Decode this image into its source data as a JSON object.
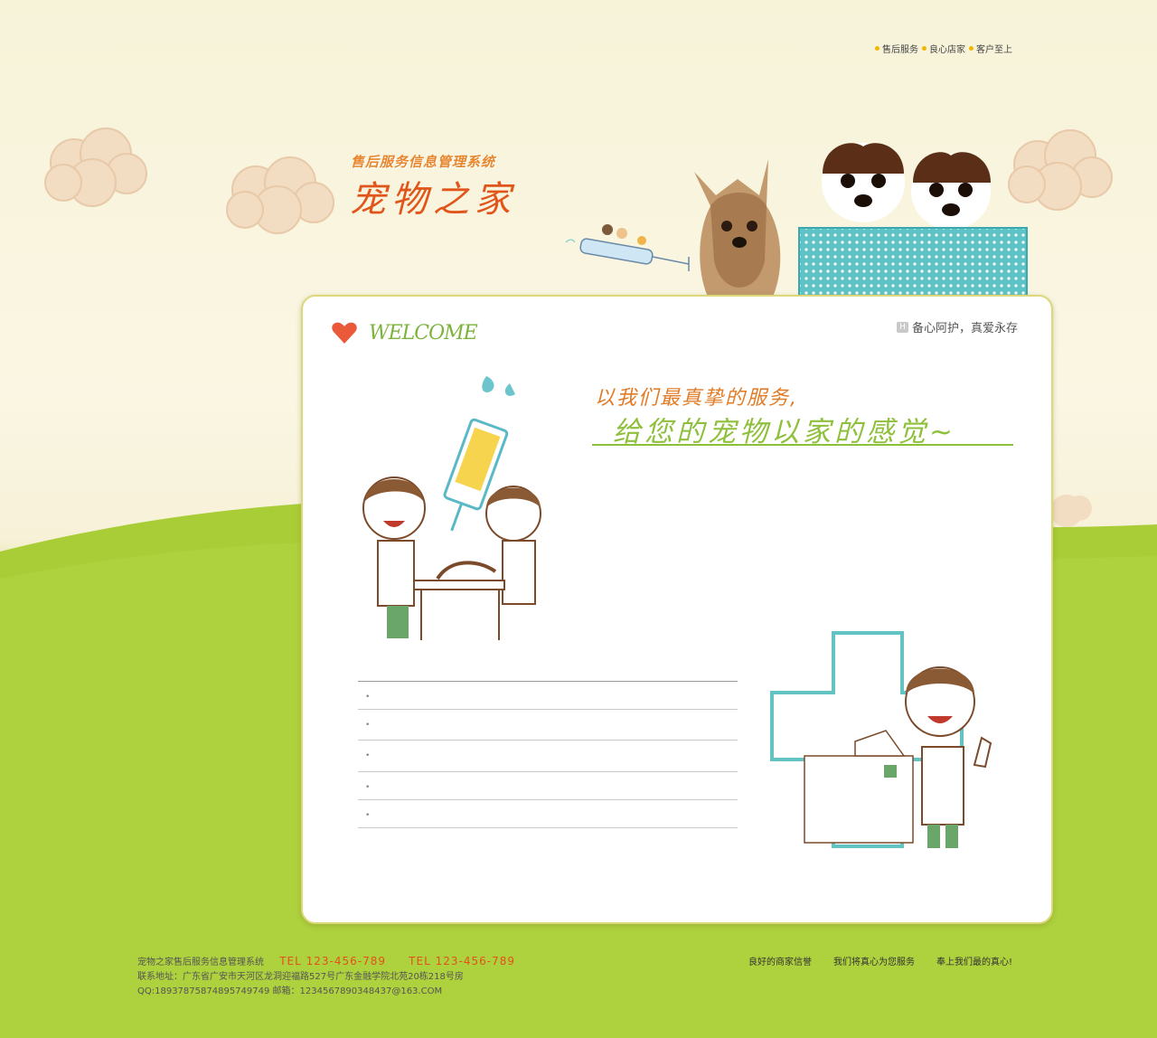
{
  "top_nav": {
    "items": [
      "售后服务",
      "良心店家",
      "客户至上"
    ]
  },
  "logo": {
    "subtitle": "售后服务信息管理系统",
    "title": "宠物之家"
  },
  "panel": {
    "welcome": "WELCOME",
    "tagline_badge": "H",
    "tagline": "备心阿护，真爱永存",
    "slogan_line1": "以我们最真挚的服务,",
    "slogan_line2": "给您的宠物以家的感觉~",
    "list_items": [
      "",
      "",
      "",
      "",
      ""
    ]
  },
  "footer": {
    "line1": "宠物之家售后服务信息管理系统",
    "tel1": "TEL 123-456-789",
    "tel2": "TEL 123-456-789",
    "line2": "联系地址：广东省广安市天河区龙洞迎福路527号广东金融学院北苑20栋218号房",
    "line3": "QQ:18937875874895749749   邮箱：1234567890348437@163.COM",
    "links": [
      "良好的商家信誉",
      "我们将真心为您服务",
      "奉上我们最的真心!"
    ]
  },
  "colors": {
    "accent_orange": "#e1551a",
    "accent_green": "#8fc03c",
    "grass": "#a9cd37"
  }
}
